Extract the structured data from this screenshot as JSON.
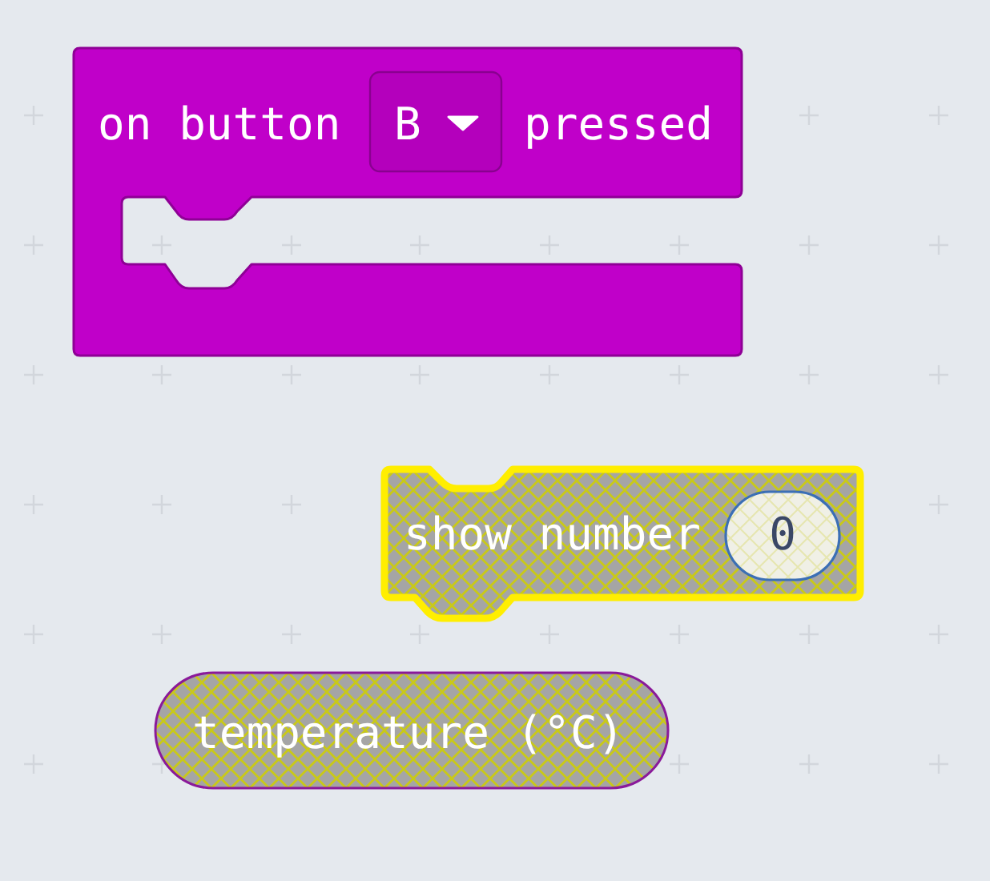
{
  "blocks": [
    {
      "kind": "event",
      "label_before": "on button",
      "dropdown": "B",
      "label_after": "pressed",
      "selected": false,
      "disabled": false
    },
    {
      "kind": "statement",
      "label": "show number",
      "value": "0",
      "selected": true,
      "disabled": true
    },
    {
      "kind": "reporter",
      "label": "temperature (°C)",
      "selected": false,
      "disabled": true
    }
  ]
}
